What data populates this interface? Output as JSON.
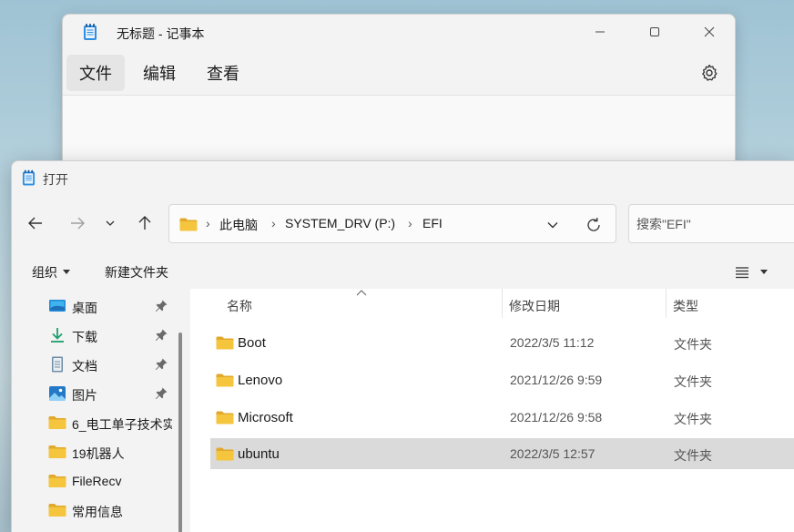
{
  "notepad": {
    "title": "无标题 - 记事本",
    "menus": [
      "文件",
      "编辑",
      "查看"
    ],
    "icons": {
      "app": "notepad-icon",
      "settings": "gear-icon"
    }
  },
  "dialog": {
    "title": "打开",
    "breadcrumb": [
      "此电脑",
      "SYSTEM_DRV (P:)",
      "EFI"
    ],
    "search_placeholder": "搜索\"EFI\"",
    "commands": {
      "organize": "组织",
      "new_folder": "新建文件夹"
    },
    "sidebar": [
      {
        "label": "桌面",
        "icon": "desktop-icon",
        "pinned": true
      },
      {
        "label": "下载",
        "icon": "download-icon",
        "pinned": true
      },
      {
        "label": "文档",
        "icon": "document-icon",
        "pinned": true
      },
      {
        "label": "图片",
        "icon": "picture-icon",
        "pinned": true
      },
      {
        "label": "6_电工单子技术实",
        "icon": "folder-icon",
        "pinned": false
      },
      {
        "label": "19机器人",
        "icon": "folder-icon",
        "pinned": false
      },
      {
        "label": "FileRecv",
        "icon": "folder-icon",
        "pinned": false
      },
      {
        "label": "常用信息",
        "icon": "folder-icon",
        "pinned": false
      }
    ],
    "columns": {
      "name": "名称",
      "date": "修改日期",
      "type": "类型"
    },
    "files": [
      {
        "name": "Boot",
        "date": "2022/3/5 11:12",
        "type": "文件夹",
        "selected": false
      },
      {
        "name": "Lenovo",
        "date": "2021/12/26 9:59",
        "type": "文件夹",
        "selected": false
      },
      {
        "name": "Microsoft",
        "date": "2021/12/26 9:58",
        "type": "文件夹",
        "selected": false
      },
      {
        "name": "ubuntu",
        "date": "2022/3/5 12:57",
        "type": "文件夹",
        "selected": true
      }
    ],
    "colors": {
      "folder": "#f4c53d",
      "folder_dark": "#e2a82b",
      "selection": "#dadada",
      "accent": "#0067c0"
    }
  }
}
